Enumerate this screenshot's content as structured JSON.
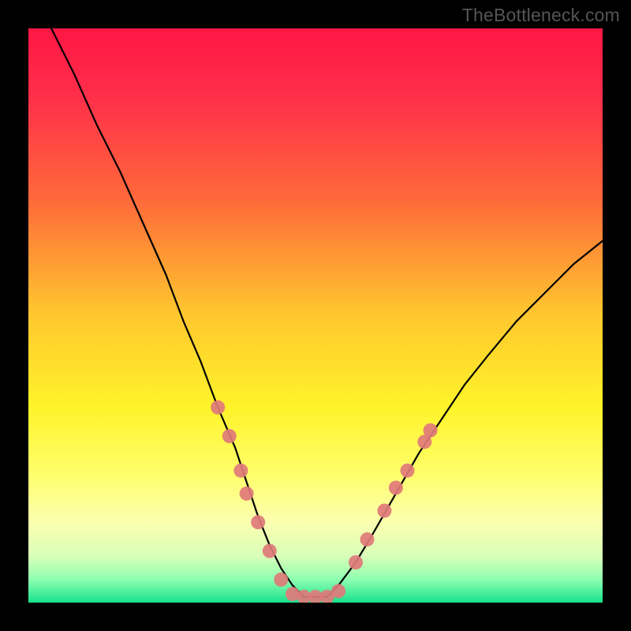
{
  "watermark": "TheBottleneck.com",
  "chart_data": {
    "type": "line",
    "title": "",
    "xlabel": "",
    "ylabel": "",
    "xlim": [
      0,
      100
    ],
    "ylim": [
      0,
      100
    ],
    "grid": false,
    "legend": false,
    "background": {
      "type": "vertical-gradient",
      "stops": [
        {
          "pos": 0.0,
          "color": "#ff1744"
        },
        {
          "pos": 0.12,
          "color": "#ff2f4a"
        },
        {
          "pos": 0.3,
          "color": "#ff6a3a"
        },
        {
          "pos": 0.5,
          "color": "#ffc82e"
        },
        {
          "pos": 0.66,
          "color": "#fff32a"
        },
        {
          "pos": 0.78,
          "color": "#ffff6e"
        },
        {
          "pos": 0.86,
          "color": "#fbffb0"
        },
        {
          "pos": 0.92,
          "color": "#d8ffb8"
        },
        {
          "pos": 0.96,
          "color": "#8dffb0"
        },
        {
          "pos": 1.0,
          "color": "#18e08c"
        }
      ]
    },
    "series": [
      {
        "name": "bottleneck-curve",
        "color": "#000000",
        "x": [
          4,
          8,
          12,
          16,
          20,
          24,
          27,
          30,
          33,
          36,
          38,
          40,
          42,
          44,
          46,
          48,
          50,
          52,
          54,
          57,
          60,
          64,
          68,
          72,
          76,
          80,
          85,
          90,
          95,
          100
        ],
        "y": [
          100,
          92,
          83,
          75,
          66,
          57,
          49,
          42,
          34,
          27,
          21,
          15,
          10,
          6,
          3,
          1,
          1,
          1,
          3,
          7,
          12,
          19,
          26,
          32,
          38,
          43,
          49,
          54,
          59,
          63
        ]
      }
    ],
    "markers": {
      "name": "highlight-dots",
      "color": "#e07a7a",
      "radius": 9,
      "points": [
        {
          "x": 33,
          "y": 34
        },
        {
          "x": 35,
          "y": 29
        },
        {
          "x": 37,
          "y": 23
        },
        {
          "x": 38,
          "y": 19
        },
        {
          "x": 40,
          "y": 14
        },
        {
          "x": 42,
          "y": 9
        },
        {
          "x": 44,
          "y": 4
        },
        {
          "x": 46,
          "y": 1.5
        },
        {
          "x": 48,
          "y": 1
        },
        {
          "x": 50,
          "y": 1
        },
        {
          "x": 52,
          "y": 1
        },
        {
          "x": 54,
          "y": 2
        },
        {
          "x": 57,
          "y": 7
        },
        {
          "x": 59,
          "y": 11
        },
        {
          "x": 62,
          "y": 16
        },
        {
          "x": 64,
          "y": 20
        },
        {
          "x": 66,
          "y": 23
        },
        {
          "x": 69,
          "y": 28
        },
        {
          "x": 70,
          "y": 30
        }
      ]
    }
  }
}
